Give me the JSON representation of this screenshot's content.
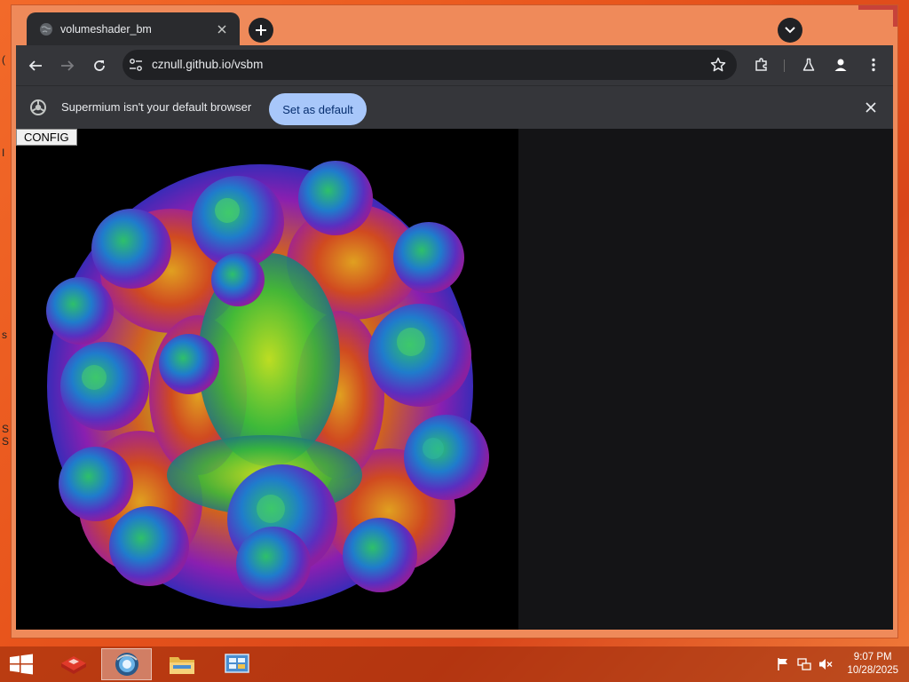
{
  "browser": {
    "tab_title": "volumeshader_bm",
    "url": "cznull.github.io/vsbm",
    "infobar_message": "Supermium isn't your default browser",
    "set_default_label": "Set as default"
  },
  "page": {
    "config_label": "CONFIG"
  },
  "taskbar": {
    "time": "9:07 PM",
    "date": "10/28/2025"
  },
  "colors": {
    "desktop_orange": "#e8551c",
    "chrome_dark": "#35363a",
    "accent_blue": "#a8c7fa",
    "close_red": "#c7423a"
  }
}
